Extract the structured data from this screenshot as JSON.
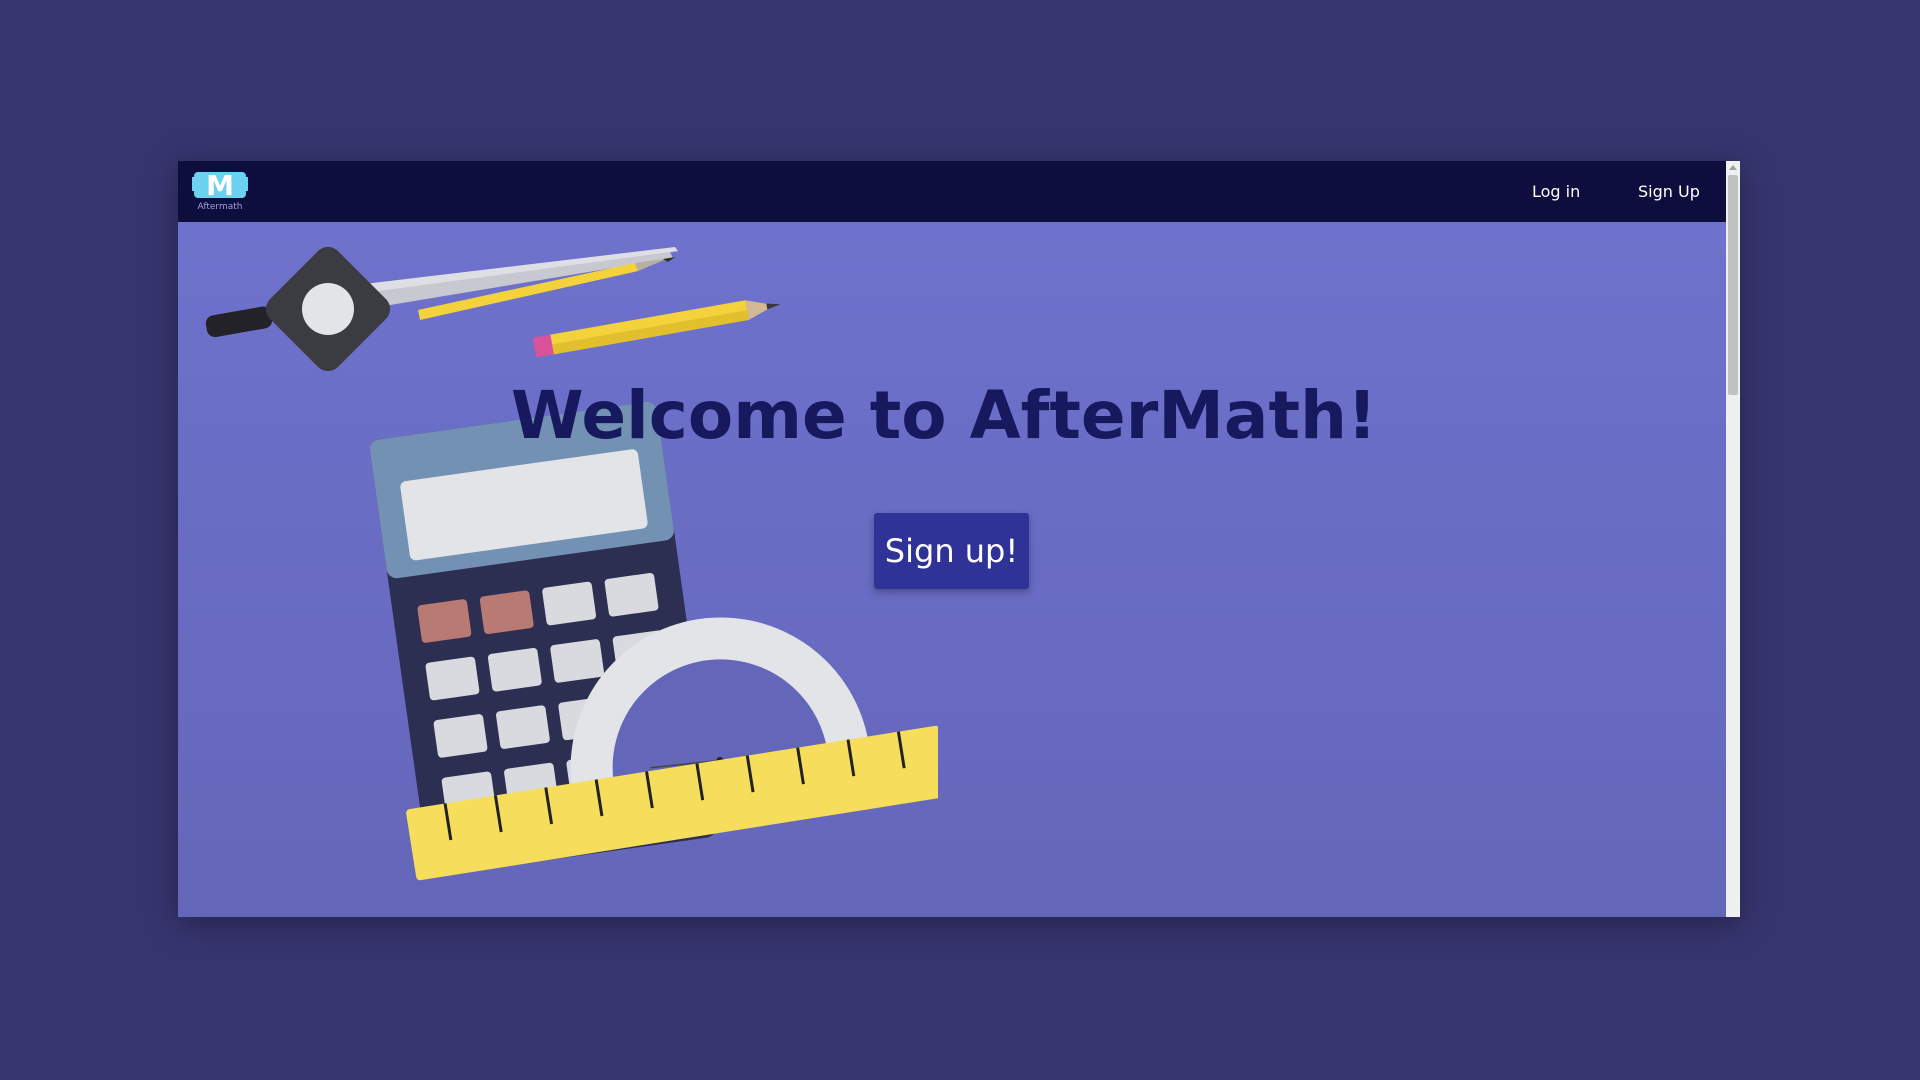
{
  "navbar": {
    "logo_text": "Aftermath",
    "logo_letter": "M",
    "login_label": "Log in",
    "signup_label": "Sign Up"
  },
  "hero": {
    "title": "Welcome to AfterMath!",
    "cta_label": "Sign up!"
  },
  "icons": {
    "illustration": [
      "compass-icon",
      "pencil-icon",
      "calculator-icon",
      "protractor-icon",
      "ruler-icon"
    ]
  },
  "colors": {
    "page_background": "#37356f",
    "navbar": "#0d0d3e",
    "hero_background": "#6a6dc5",
    "title": "#17195e",
    "button": "#2f3296"
  }
}
